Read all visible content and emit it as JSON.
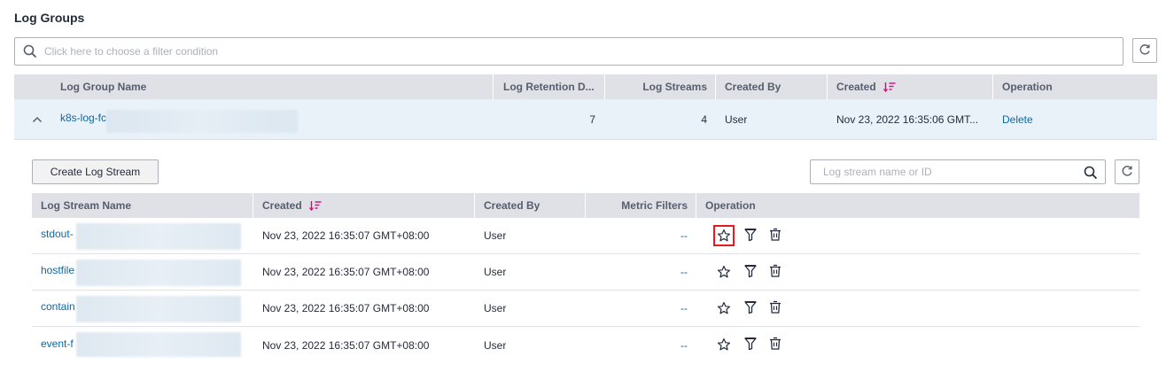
{
  "page": {
    "title": "Log Groups"
  },
  "filter": {
    "placeholder": "Click here to choose a filter condition"
  },
  "log_groups_table": {
    "columns": [
      "Log Group Name",
      "Log Retention D...",
      "Log Streams",
      "Created By",
      "Created",
      "Operation"
    ],
    "rows": [
      {
        "name": "k8s-log-fc",
        "retention": "7",
        "streams": "4",
        "created_by": "User",
        "created": "Nov 23, 2022 16:35:06 GMT...",
        "operation": "Delete"
      }
    ]
  },
  "streams_panel": {
    "create_label": "Create Log Stream",
    "search_placeholder": "Log stream name or ID",
    "columns": [
      "Log Stream Name",
      "Created",
      "Created By",
      "Metric Filters",
      "Operation"
    ],
    "rows": [
      {
        "name": "stdout-",
        "created": "Nov 23, 2022 16:35:07 GMT+08:00",
        "created_by": "User",
        "metric_filters": "--"
      },
      {
        "name": "hostfile",
        "created": "Nov 23, 2022 16:35:07 GMT+08:00",
        "created_by": "User",
        "metric_filters": "--"
      },
      {
        "name": "contain",
        "created": "Nov 23, 2022 16:35:07 GMT+08:00",
        "created_by": "User",
        "metric_filters": "--"
      },
      {
        "name": "event-f",
        "created": "Nov 23, 2022 16:35:07 GMT+08:00",
        "created_by": "User",
        "metric_filters": "--"
      }
    ],
    "operation_icons": [
      "star-icon",
      "filter-icon",
      "trash-icon"
    ]
  },
  "colors": {
    "link": "#0d67a7",
    "header_bg": "#dfe1e6",
    "expanded_row_bg": "#e9f2f9",
    "sort_accent": "#e6007e",
    "highlight": "#e61a1a"
  }
}
